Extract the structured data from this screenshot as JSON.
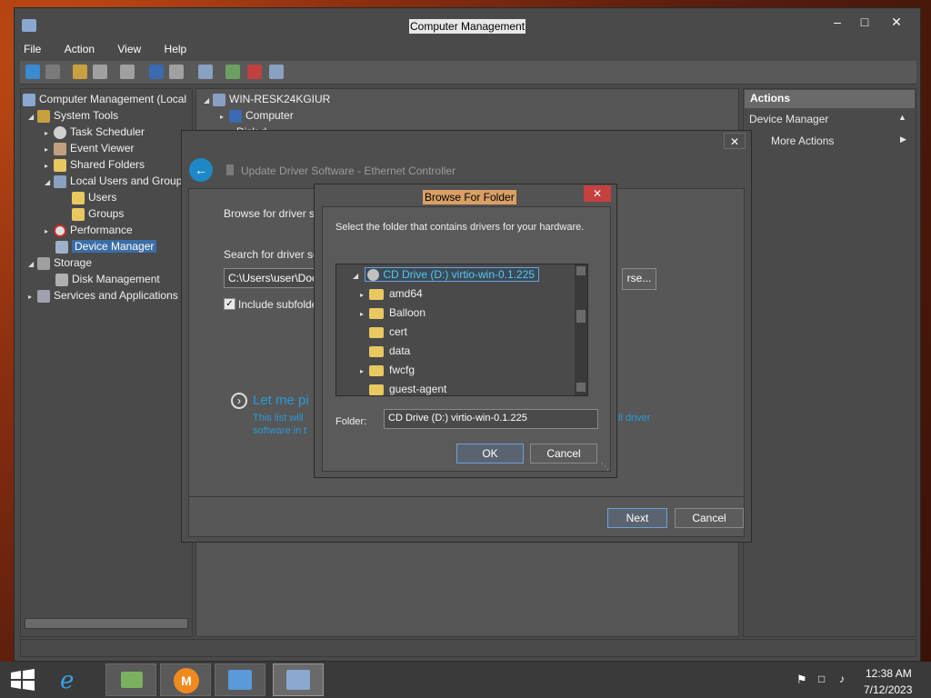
{
  "window": {
    "title": "Computer Management",
    "minimize": "–",
    "maximize": "□",
    "close": "✕"
  },
  "menu": [
    "File",
    "Action",
    "View",
    "Help"
  ],
  "tree": {
    "root": "Computer Management (Local",
    "system_tools": "System Tools",
    "task_scheduler": "Task Scheduler",
    "event_viewer": "Event Viewer",
    "shared_folders": "Shared Folders",
    "local_users": "Local Users and Group",
    "users": "Users",
    "groups": "Groups",
    "performance": "Performance",
    "device_manager": "Device Manager",
    "storage": "Storage",
    "disk_management": "Disk Management",
    "services": "Services and Applications"
  },
  "middle": {
    "host": "WIN-RESK24KGIUR",
    "computer": "Computer",
    "disk": "Disk d"
  },
  "actions": {
    "header": "Actions",
    "section": "Device Manager",
    "more": "More Actions"
  },
  "wizard": {
    "close": "✕",
    "title": "Update Driver Software - Ethernet Controller",
    "browse_heading": "Browse for driver sc",
    "search_label": "Search for driver so",
    "path": "C:\\Users\\user\\Doc",
    "browse_button": "rse...",
    "include_sub": "Include subfolde",
    "let_me": "Let me pi",
    "desc_line1": "This list will",
    "desc_line1_end": "ll driver",
    "desc_line2": "software in t",
    "next": "Next",
    "cancel": "Cancel"
  },
  "browse": {
    "title": "Browse For Folder",
    "close": "✕",
    "instructions": "Select the folder that contains drivers for your hardware.",
    "root": "CD Drive (D:) virtio-win-0.1.225",
    "folders": [
      {
        "name": "amd64",
        "expandable": true
      },
      {
        "name": "Balloon",
        "expandable": true
      },
      {
        "name": "cert",
        "expandable": false
      },
      {
        "name": "data",
        "expandable": false
      },
      {
        "name": "fwcfg",
        "expandable": true
      },
      {
        "name": "guest-agent",
        "expandable": false
      }
    ],
    "folder_label": "Folder:",
    "folder_value": "CD Drive (D:) virtio-win-0.1.225",
    "ok": "OK",
    "cancel": "Cancel"
  },
  "taskbar": {
    "time": "12:38 AM",
    "date": "7/12/2023"
  },
  "colors": {
    "accent": "#1e88c7",
    "selection": "#3b6ea5",
    "folder": "#e8c860"
  }
}
